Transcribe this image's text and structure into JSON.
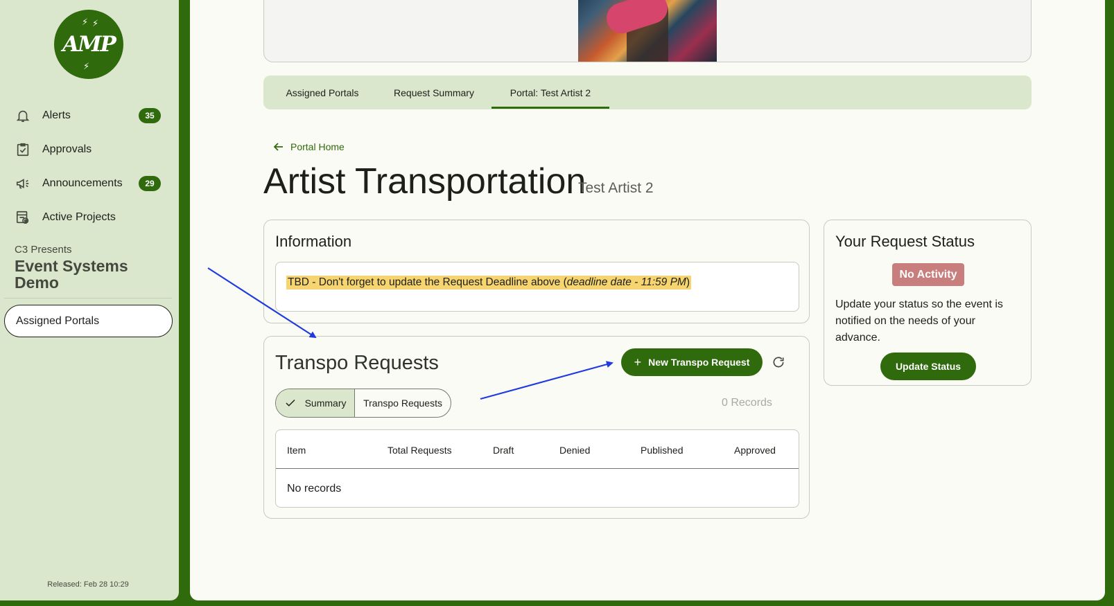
{
  "sidebar": {
    "logo_text": "AMP",
    "items": [
      {
        "label": "Alerts",
        "icon": "bell-icon",
        "badge": "35"
      },
      {
        "label": "Approvals",
        "icon": "clipboard-check-icon",
        "badge": null
      },
      {
        "label": "Announcements",
        "icon": "megaphone-icon",
        "badge": "29"
      },
      {
        "label": "Active Projects",
        "icon": "projects-icon",
        "badge": null
      }
    ],
    "org_presenter": "C3 Presents",
    "org_name": "Event Systems Demo",
    "assigned_portals": "Assigned Portals",
    "released": "Released: Feb 28 10:29"
  },
  "tabs": [
    {
      "label": "Assigned Portals",
      "active": false
    },
    {
      "label": "Request Summary",
      "active": false
    },
    {
      "label": "Portal: Test Artist 2",
      "active": true
    }
  ],
  "back_link": "Portal Home",
  "page": {
    "title": "Artist Transportation",
    "subtitle": "Test Artist 2"
  },
  "information": {
    "title": "Information",
    "text_prefix": "TBD - Don't forget to update the Request Deadline above (",
    "text_italic": "deadline date - 11:59 PM",
    "text_suffix": ")"
  },
  "transpo": {
    "title": "Transpo Requests",
    "new_button": "New Transpo Request",
    "segments": [
      "Summary",
      "Transpo Requests"
    ],
    "selected_segment": "Summary",
    "records_count": "0 Records",
    "columns": [
      "Item",
      "Total Requests",
      "Draft",
      "Denied",
      "Published",
      "Approved"
    ],
    "empty_text": "No records"
  },
  "status": {
    "title": "Your Request Status",
    "badge": "No Activity",
    "badge_color": "#c97e7e",
    "description": "Update your status so the event is notified on the needs of your advance.",
    "button": "Update Status"
  },
  "colors": {
    "brand": "#2f6a0c",
    "sidebar_bg": "#dbe7cd",
    "highlight": "#f6d46f",
    "annotation_arrow": "#1f3be0"
  }
}
